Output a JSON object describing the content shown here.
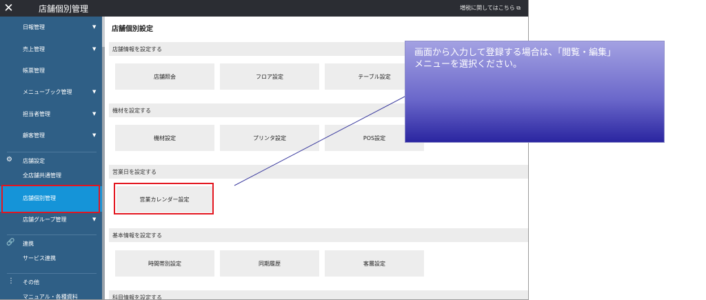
{
  "window": {
    "title": "店舗個別管理",
    "close_glyph": "✕",
    "tax_link": "増税に関してはこちら",
    "external_icon": "external-link-icon"
  },
  "sidebar": {
    "items": [
      {
        "label": "日報管理",
        "caret": true
      },
      {
        "label": "売上管理",
        "caret": true
      },
      {
        "label": "帳票管理",
        "caret": false
      },
      {
        "label": "メニューブック管理",
        "caret": true
      },
      {
        "label": "担当者管理",
        "caret": true
      },
      {
        "label": "顧客管理",
        "caret": true
      }
    ],
    "store_section": {
      "title": "店舗設定",
      "items": [
        "全店舗共通管理",
        "店舗個別管理",
        "店舗グループ管理"
      ]
    },
    "link_section": {
      "title": "連携",
      "items": [
        "サービス連携"
      ]
    },
    "other_section": {
      "title": "その他",
      "items": [
        "マニュアル・各種資料"
      ]
    },
    "active_item": "店舗個別管理"
  },
  "main": {
    "title": "店舗個別設定",
    "sections": [
      {
        "heading": "店舗情報を設定する",
        "buttons": [
          "店舗照会",
          "フロア設定",
          "テーブル設定"
        ]
      },
      {
        "heading": "機材を設定する",
        "buttons": [
          "機材設定",
          "プリンタ設定",
          "POS設定"
        ]
      },
      {
        "heading": "営業日を設定する",
        "buttons": [
          "営業カレンダー設定"
        ]
      },
      {
        "heading": "基本情報を設定する",
        "buttons": [
          "時間帯別設定",
          "同期履歴",
          "客層設定"
        ]
      },
      {
        "heading": "科目情報を設定する",
        "buttons": []
      }
    ]
  },
  "callout": {
    "text": "画面から入力して登録する場合は、「閲覧・編集」メニューを選択ください。"
  },
  "colors": {
    "sidebar": "#2f5f86",
    "active": "#1594d8",
    "highlight": "#e3151f",
    "topbar": "#2b2d33"
  }
}
